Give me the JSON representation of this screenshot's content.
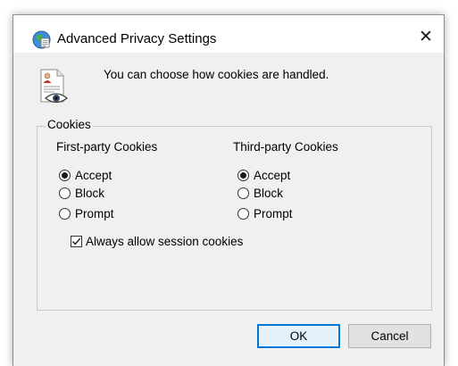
{
  "window": {
    "title": "Advanced Privacy Settings",
    "title_icon": "privacy-settings-icon",
    "close_glyph": "✕"
  },
  "header": {
    "icon": "privacy-document-eye-icon",
    "text": "You can choose how cookies are handled."
  },
  "cookies": {
    "group_label": "Cookies",
    "first_party": {
      "heading": "First-party Cookies",
      "options": [
        {
          "label": "Accept",
          "selected": true
        },
        {
          "label": "Block",
          "selected": false
        },
        {
          "label": "Prompt",
          "selected": false
        }
      ]
    },
    "third_party": {
      "heading": "Third-party Cookies",
      "options": [
        {
          "label": "Accept",
          "selected": true
        },
        {
          "label": "Block",
          "selected": false
        },
        {
          "label": "Prompt",
          "selected": false
        }
      ]
    },
    "session": {
      "label": "Always allow session cookies",
      "checked": true
    }
  },
  "buttons": {
    "ok": "OK",
    "cancel": "Cancel"
  },
  "colors": {
    "dialog_background": "#f0f0f0",
    "titlebar_background": "#ffffff",
    "default_button_border": "#0078d7",
    "default_button_fill": "#e5f1fb",
    "button_fill": "#e1e1e1"
  }
}
